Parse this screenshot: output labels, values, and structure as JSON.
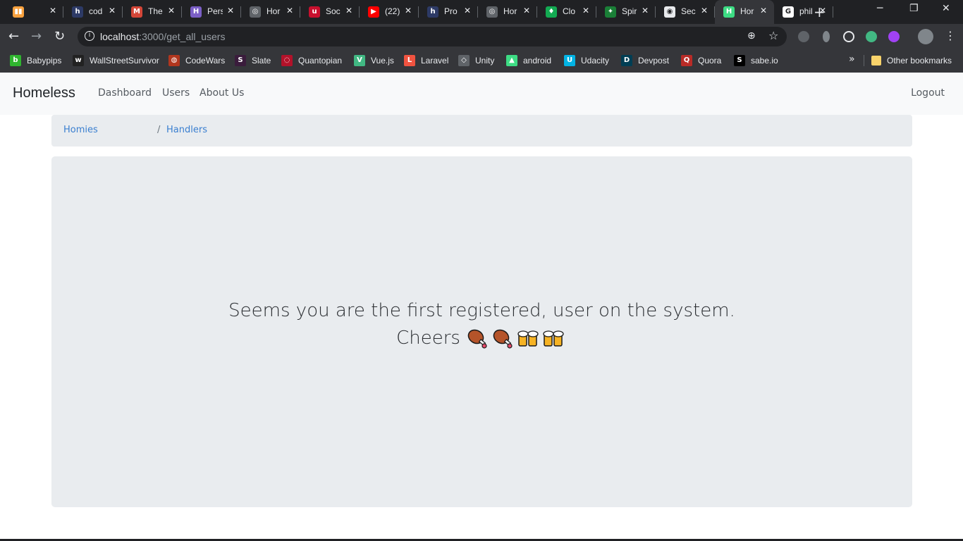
{
  "browser": {
    "tabs": [
      {
        "title": "",
        "fav_color": "#f8a13e",
        "fav_text": "▮▮",
        "active": false
      },
      {
        "title": "cod",
        "fav_color": "#2d3a66",
        "fav_text": "h",
        "active": false
      },
      {
        "title": "The",
        "fav_color": "#d44638",
        "fav_text": "M",
        "active": false
      },
      {
        "title": "Pers",
        "fav_color": "#7b5fc6",
        "fav_text": "H",
        "active": false
      },
      {
        "title": "Hor",
        "fav_color": "#5f6368",
        "fav_text": "◎",
        "active": false
      },
      {
        "title": "Soc",
        "fav_color": "#c8102e",
        "fav_text": "u",
        "active": false
      },
      {
        "title": "(22)",
        "fav_color": "#ff0000",
        "fav_text": "▶",
        "active": false
      },
      {
        "title": "Pro",
        "fav_color": "#2d3a66",
        "fav_text": "h",
        "active": false
      },
      {
        "title": "Hor",
        "fav_color": "#5f6368",
        "fav_text": "◎",
        "active": false
      },
      {
        "title": "Clo",
        "fav_color": "#13aa52",
        "fav_text": "♦",
        "active": false
      },
      {
        "title": "Spir",
        "fav_color": "#1a7f37",
        "fav_text": "✦",
        "active": false
      },
      {
        "title": "Sec",
        "fav_color": "#e8eaed",
        "fav_text": "◉",
        "active": false
      },
      {
        "title": "Hor",
        "fav_color": "#3ddc84",
        "fav_text": "H",
        "active": true
      },
      {
        "title": "phil",
        "fav_color": "#ffffff",
        "fav_text": "G",
        "active": false
      }
    ],
    "new_tab_label": "+",
    "url_host": "localhost",
    "url_rest": ":3000/get_all_users",
    "bookmarks": [
      {
        "label": "Babypips",
        "icon_color": "#2fb52f",
        "icon_text": "b"
      },
      {
        "label": "WallStreetSurvivor",
        "icon_color": "#222222",
        "icon_text": "w"
      },
      {
        "label": "CodeWars",
        "icon_color": "#b1361e",
        "icon_text": "◍"
      },
      {
        "label": "Slate",
        "icon_color": "#3a1c3c",
        "icon_text": "S"
      },
      {
        "label": "Quantopian",
        "icon_color": "#b3122a",
        "icon_text": "◌"
      },
      {
        "label": "Vue.js",
        "icon_color": "#41b883",
        "icon_text": "V"
      },
      {
        "label": "Laravel",
        "icon_color": "#f05340",
        "icon_text": "L"
      },
      {
        "label": "Unity",
        "icon_color": "#5f6368",
        "icon_text": "◇"
      },
      {
        "label": "android",
        "icon_color": "#3ddc84",
        "icon_text": "▲"
      },
      {
        "label": "Udacity",
        "icon_color": "#02b3e4",
        "icon_text": "U"
      },
      {
        "label": "Devpost",
        "icon_color": "#003e54",
        "icon_text": "D"
      },
      {
        "label": "Quora",
        "icon_color": "#b92b27",
        "icon_text": "Q"
      },
      {
        "label": "sabe.io",
        "icon_color": "#000000",
        "icon_text": "S"
      }
    ],
    "more_bookmarks": "»",
    "other_bookmarks": "Other bookmarks"
  },
  "navbar": {
    "brand": "Homeless",
    "links": [
      "Dashboard",
      "Users",
      "About Us"
    ],
    "logout": "Logout"
  },
  "breadcrumb": {
    "items": [
      "Homies",
      "Handlers"
    ],
    "separator": "/"
  },
  "main": {
    "message_line1": "Seems you are the first registered, user on the system.",
    "message_line2": "Cheers",
    "emojis": [
      "meat-on-bone",
      "meat-on-bone",
      "clinking-beer-mugs",
      "clinking-beer-mugs"
    ]
  }
}
